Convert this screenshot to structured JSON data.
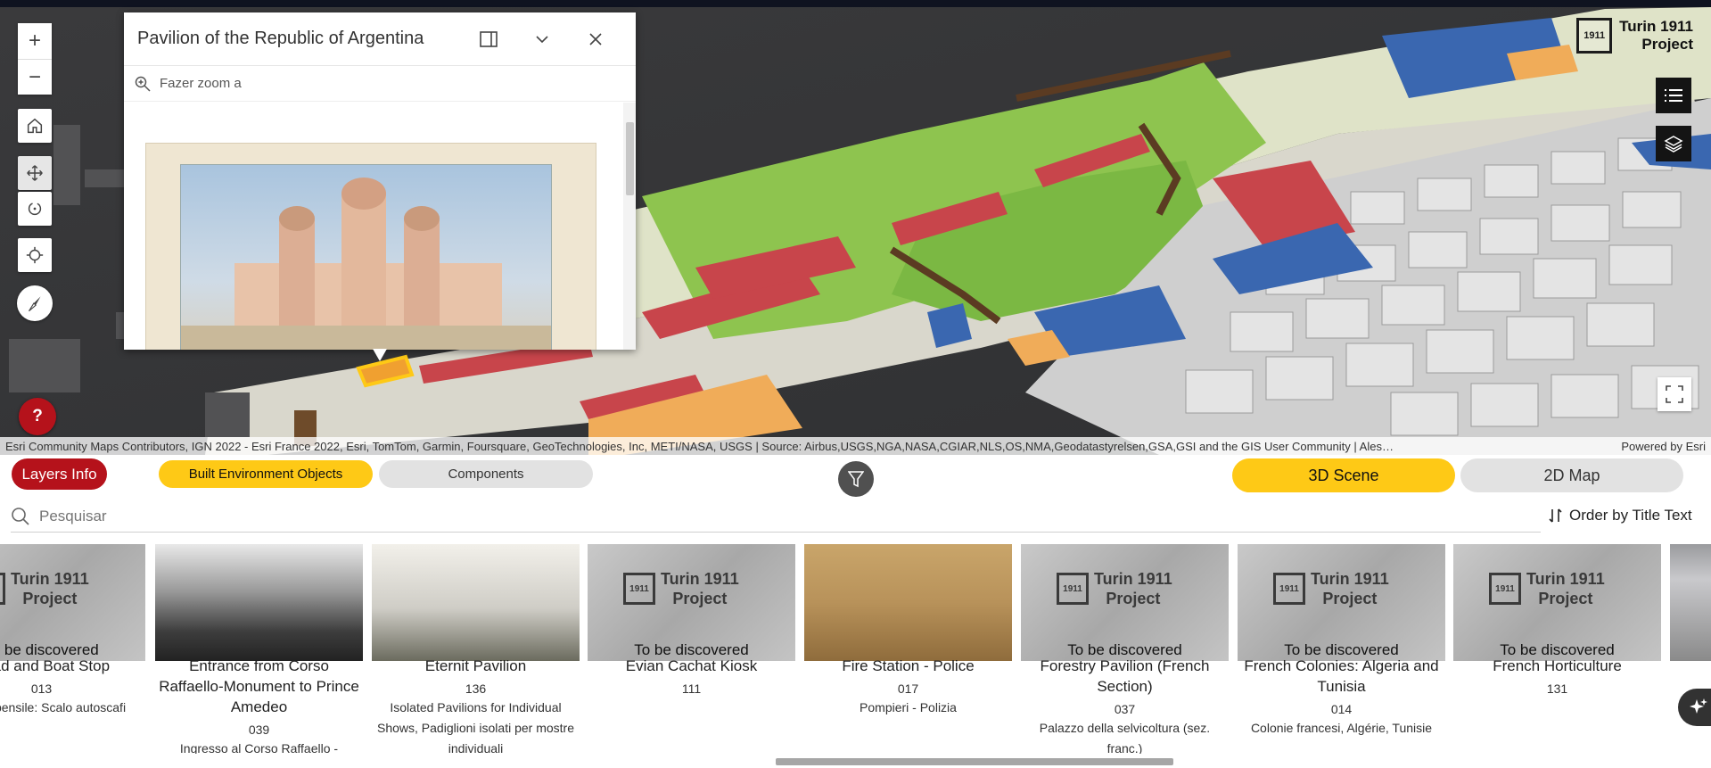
{
  "popup": {
    "title": "Pavilion of the Republic of Argentina",
    "zoom_label": "Fazer zoom a"
  },
  "logo": {
    "mark": "1911",
    "line1": "Turin 1911",
    "line2": "Project"
  },
  "map_tools": {
    "zoom_in": "+",
    "zoom_out": "−",
    "help": "?"
  },
  "attribution": {
    "text": "Esri Community Maps Contributors, IGN 2022 - Esri France 2022, Esri, TomTom, Garmin, Foursquare, GeoTechnologies, Inc, METI/NASA, USGS | Source: Airbus,USGS,NGA,NASA,CGIAR,NLS,OS,NMA,Geodatastyrelsen,GSA,GSI and the GIS User Community | Ales…",
    "powered": "Powered by Esri"
  },
  "panel": {
    "layers_info": "Layers Info",
    "tab_built": "Built Environment Objects",
    "tab_components": "Components",
    "scene_3d": "3D Scene",
    "map_2d": "2D Map",
    "search_placeholder": "Pesquisar",
    "order_label": "Order by Title Text"
  },
  "cards": [
    {
      "title": "Road and Boat Stop",
      "num": "013",
      "desc": "ggiata pensile: Scalo autoscafi",
      "tbd": "To be discovered",
      "placeholder": true
    },
    {
      "title": "Entrance from Corso Raffaello-Monument to Prince Amedeo",
      "num": "039",
      "desc": "Ingresso al Corso Raffaello -",
      "tbd": "",
      "placeholder": false
    },
    {
      "title": "Eternit Pavilion",
      "num": "136",
      "desc": "Isolated Pavilions for Individual Shows, Padiglioni isolati per mostre individuali",
      "tbd": "",
      "placeholder": false
    },
    {
      "title": "Evian Cachat Kiosk",
      "num": "111",
      "desc": "",
      "tbd": "To be discovered",
      "placeholder": true
    },
    {
      "title": "Fire Station - Police",
      "num": "017",
      "desc": "Pompieri - Polizia",
      "tbd": "",
      "placeholder": false
    },
    {
      "title": "Forestry Pavilion (French Section)",
      "num": "037",
      "desc": "Palazzo della selvicoltura (sez. franc.)",
      "tbd": "To be discovered",
      "placeholder": true
    },
    {
      "title": "French Colonies: Algeria and Tunisia",
      "num": "014",
      "desc": "Colonie francesi, Algérie, Tunisie",
      "tbd": "To be discovered",
      "placeholder": true
    },
    {
      "title": "French Horticulture",
      "num": "131",
      "desc": "",
      "tbd": "To be discovered",
      "placeholder": true
    }
  ],
  "placeholder_text": {
    "line1": "Turin 1911",
    "line2": "Project",
    "mark": "1911"
  },
  "colors": {
    "accent_red": "#b5121b",
    "accent_yellow": "#fec916",
    "pill_gray": "#e2e2e2"
  },
  "icons": [
    "plus-icon",
    "minus-icon",
    "home-icon",
    "pan-icon",
    "rotate-icon",
    "locate-icon",
    "compass-icon",
    "help-icon",
    "dock-icon",
    "chevron-down-icon",
    "close-icon",
    "zoom-to-icon",
    "list-icon",
    "layers-icon",
    "fullscreen-icon",
    "filter-icon",
    "search-icon",
    "sort-icon",
    "ai-sparkle-icon"
  ]
}
